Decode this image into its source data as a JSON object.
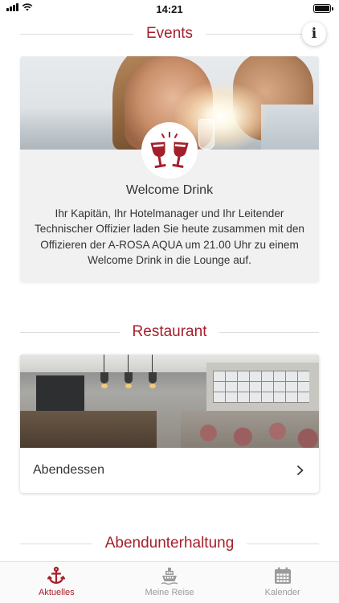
{
  "status_bar": {
    "time": "14:21"
  },
  "events": {
    "heading": "Events",
    "info_label": "i",
    "card": {
      "title": "Welcome Drink",
      "text": "Ihr Kapitän, Ihr Hotelmanager und Ihr Leitender Technischer Offizier laden Sie heute zusammen mit den Offizieren der A-ROSA AQUA um 21.00 Uhr zu einem Welcome Drink in die Lounge auf.",
      "icon": "wine-glasses-icon"
    }
  },
  "restaurant": {
    "heading": "Restaurant",
    "card": {
      "label": "Abendessen",
      "icon": "chevron-right-icon"
    }
  },
  "evening": {
    "heading": "Abendunterhaltung"
  },
  "tabs": [
    {
      "label": "Aktuelles",
      "icon": "anchor-icon",
      "active": true
    },
    {
      "label": "Meine Reise",
      "icon": "ship-icon",
      "active": false
    },
    {
      "label": "Kalender",
      "icon": "calendar-icon",
      "active": false
    }
  ],
  "colors": {
    "accent": "#a51f2b",
    "inactive": "#9a9a9a"
  }
}
